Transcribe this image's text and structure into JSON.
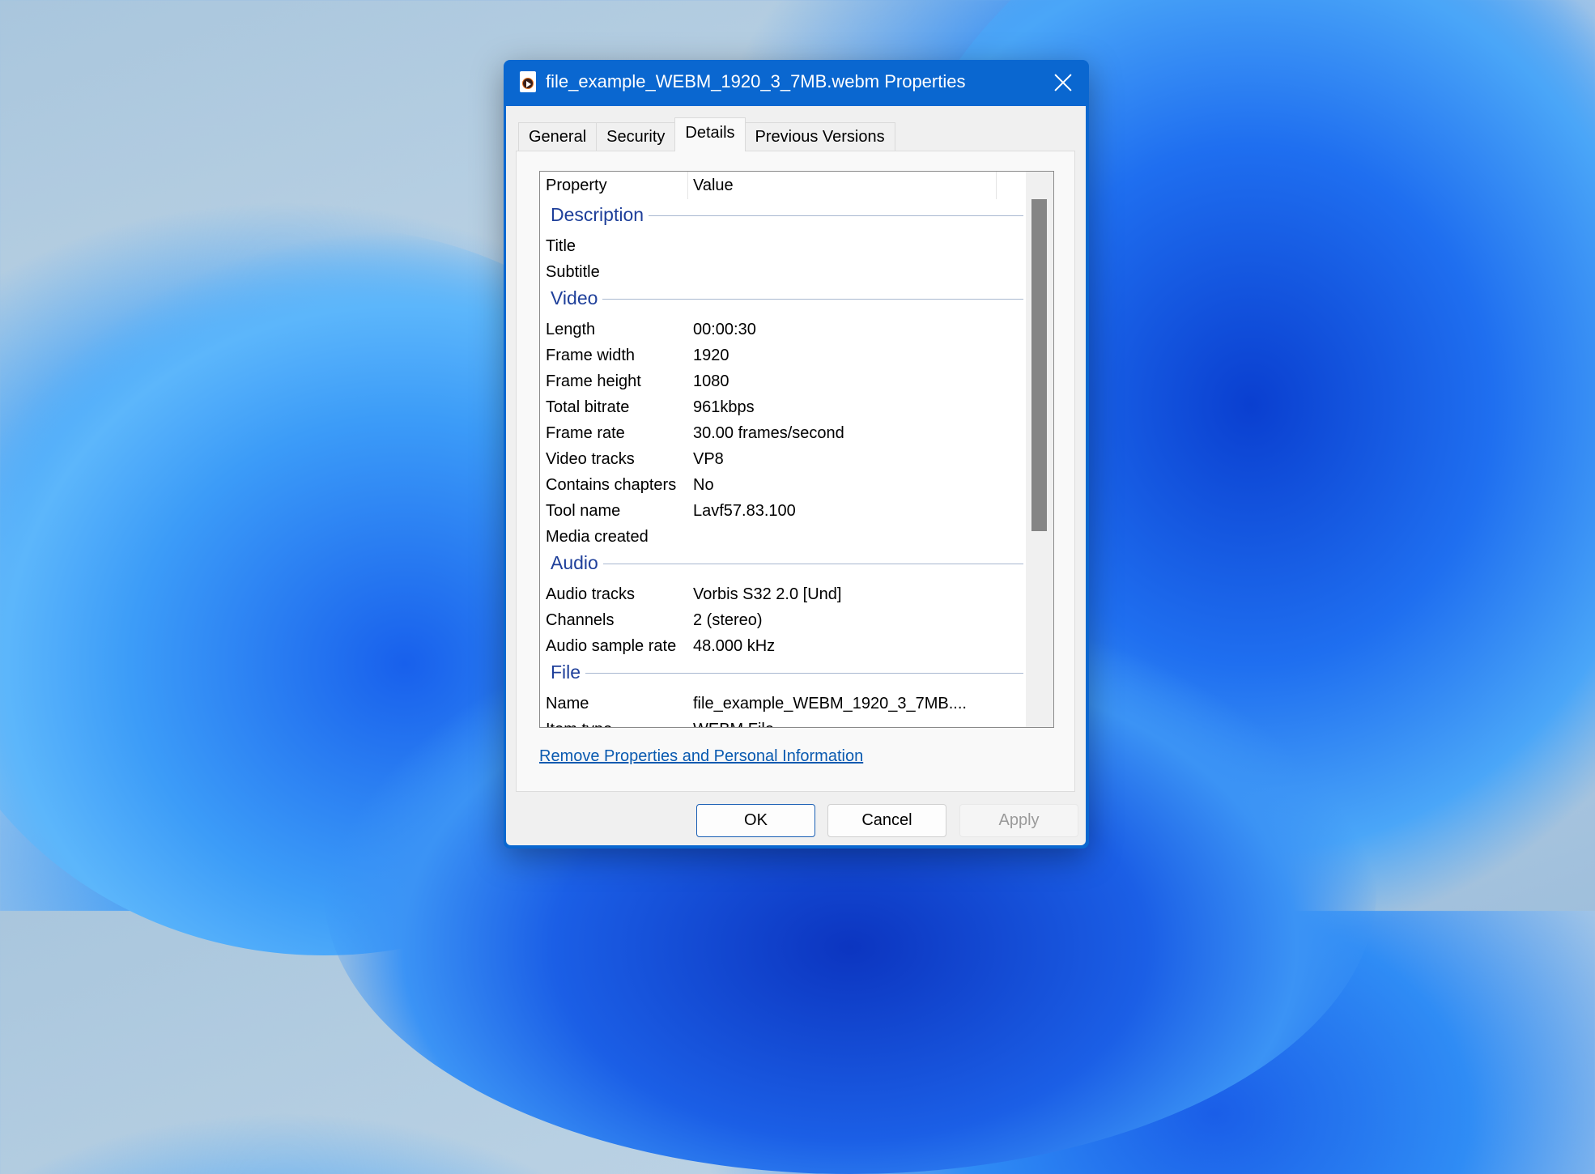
{
  "dialog": {
    "title": "file_example_WEBM_1920_3_7MB.webm Properties",
    "title_icon": "video-file-icon",
    "close_icon": "close-icon"
  },
  "tabs": [
    {
      "label": "General",
      "selected": false
    },
    {
      "label": "Security",
      "selected": false
    },
    {
      "label": "Details",
      "selected": true
    },
    {
      "label": "Previous Versions",
      "selected": false
    }
  ],
  "details": {
    "columns": {
      "property": "Property",
      "value": "Value"
    },
    "groups": [
      {
        "label": "Description",
        "rows": [
          {
            "property": "Title",
            "value": ""
          },
          {
            "property": "Subtitle",
            "value": ""
          }
        ]
      },
      {
        "label": "Video",
        "rows": [
          {
            "property": "Length",
            "value": "00:00:30"
          },
          {
            "property": "Frame width",
            "value": "1920"
          },
          {
            "property": "Frame height",
            "value": "1080"
          },
          {
            "property": "Total bitrate",
            "value": "961kbps"
          },
          {
            "property": "Frame rate",
            "value": "30.00 frames/second"
          },
          {
            "property": "Video tracks",
            "value": "VP8"
          },
          {
            "property": "Contains chapters",
            "value": "No"
          },
          {
            "property": "Tool name",
            "value": "Lavf57.83.100"
          },
          {
            "property": "Media created",
            "value": ""
          }
        ]
      },
      {
        "label": "Audio",
        "rows": [
          {
            "property": "Audio tracks",
            "value": "Vorbis S32 2.0 [Und]"
          },
          {
            "property": "Channels",
            "value": "2 (stereo)"
          },
          {
            "property": "Audio sample rate",
            "value": "48.000 kHz"
          }
        ]
      },
      {
        "label": "File",
        "rows": [
          {
            "property": "Name",
            "value": "file_example_WEBM_1920_3_7MB...."
          },
          {
            "property": "Item type",
            "value": "WEBM File"
          }
        ]
      }
    ],
    "scroll_position_fraction": 0.0,
    "scroll_visible_fraction": 0.63
  },
  "remove_link": "Remove Properties and Personal Information",
  "buttons": {
    "ok": "OK",
    "cancel": "Cancel",
    "apply": "Apply",
    "apply_enabled": false
  },
  "colors": {
    "titlebar": "#0a67d0",
    "group_label": "#1e3f9a",
    "link": "#0a5ab0"
  }
}
